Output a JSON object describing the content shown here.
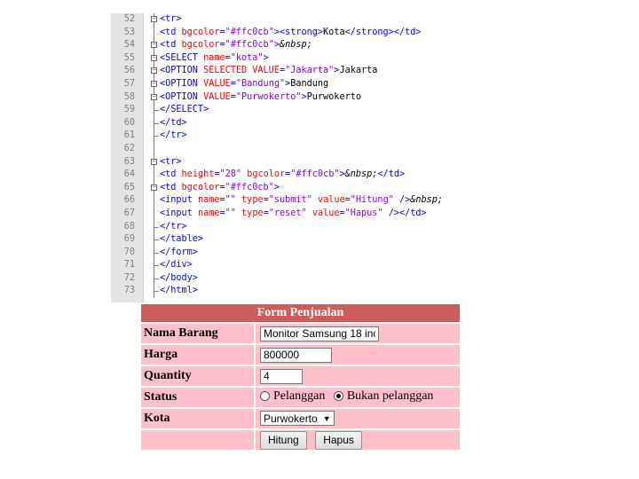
{
  "editor": {
    "lines": [
      {
        "num": "52",
        "fold": "minus",
        "tokens": [
          [
            "tag",
            "<tr>"
          ]
        ]
      },
      {
        "num": "53",
        "fold": "bar",
        "tokens": [
          [
            "tag",
            "<td "
          ],
          [
            "attr",
            "bgcolor"
          ],
          [
            "tag",
            "="
          ],
          [
            "val",
            "\"#ffc0cb\""
          ],
          [
            "tag",
            ">"
          ],
          [
            "tag",
            "<strong>"
          ],
          [
            "plain",
            "Kota"
          ],
          [
            "tag",
            "</strong>"
          ],
          [
            "tag",
            "</td>"
          ]
        ]
      },
      {
        "num": "54",
        "fold": "minus",
        "tokens": [
          [
            "tag",
            "<td "
          ],
          [
            "attr",
            "bgcolor"
          ],
          [
            "tag",
            "="
          ],
          [
            "val",
            "\"#ffc0cb\""
          ],
          [
            "tag",
            ">"
          ],
          [
            "ent",
            "&nbsp;"
          ]
        ]
      },
      {
        "num": "55",
        "fold": "minus",
        "tokens": [
          [
            "tag",
            "<SELECT "
          ],
          [
            "attr",
            "name"
          ],
          [
            "tag",
            "="
          ],
          [
            "val",
            "\"kota\""
          ],
          [
            "tag",
            ">"
          ]
        ]
      },
      {
        "num": "56",
        "fold": "minus",
        "tokens": [
          [
            "tag",
            "<OPTION "
          ],
          [
            "attr",
            "SELECTED VALUE"
          ],
          [
            "tag",
            "="
          ],
          [
            "val",
            "\"Jakarta\""
          ],
          [
            "tag",
            ">"
          ],
          [
            "plain",
            "Jakarta"
          ]
        ]
      },
      {
        "num": "57",
        "fold": "minus",
        "tokens": [
          [
            "tag",
            "<OPTION "
          ],
          [
            "attr",
            "VALUE"
          ],
          [
            "tag",
            "="
          ],
          [
            "val",
            "\"Bandung\""
          ],
          [
            "tag",
            ">"
          ],
          [
            "plain",
            "Bandung"
          ]
        ]
      },
      {
        "num": "58",
        "fold": "minus",
        "tokens": [
          [
            "tag",
            "<OPTION "
          ],
          [
            "attr",
            "VALUE"
          ],
          [
            "tag",
            "="
          ],
          [
            "val",
            "\"Purwokerto\""
          ],
          [
            "tag",
            ">"
          ],
          [
            "plain",
            "Purwokerto"
          ]
        ]
      },
      {
        "num": "59",
        "fold": "end",
        "tokens": [
          [
            "tag",
            "</SELECT>"
          ]
        ]
      },
      {
        "num": "60",
        "fold": "end",
        "tokens": [
          [
            "tag",
            "</td>"
          ]
        ]
      },
      {
        "num": "61",
        "fold": "end",
        "tokens": [
          [
            "tag",
            "</tr>"
          ]
        ]
      },
      {
        "num": "62",
        "fold": "bar",
        "tokens": []
      },
      {
        "num": "63",
        "fold": "minus",
        "tokens": [
          [
            "tag",
            "<tr>"
          ]
        ]
      },
      {
        "num": "64",
        "fold": "bar",
        "tokens": [
          [
            "tag",
            "<td "
          ],
          [
            "attr",
            "height"
          ],
          [
            "tag",
            "="
          ],
          [
            "val",
            "\"28\""
          ],
          [
            "tag",
            " "
          ],
          [
            "attr",
            "bgcolor"
          ],
          [
            "tag",
            "="
          ],
          [
            "val",
            "\"#ffc0cb\""
          ],
          [
            "tag",
            ">"
          ],
          [
            "ent",
            "&nbsp;"
          ],
          [
            "tag",
            "</td>"
          ]
        ]
      },
      {
        "num": "65",
        "fold": "minus",
        "tokens": [
          [
            "tag",
            "<td "
          ],
          [
            "attr",
            "bgcolor"
          ],
          [
            "tag",
            "="
          ],
          [
            "val",
            "\"#ffc0cb\""
          ],
          [
            "tag",
            ">"
          ]
        ]
      },
      {
        "num": "66",
        "fold": "bar",
        "tokens": [
          [
            "tag",
            "<input "
          ],
          [
            "attr",
            "name"
          ],
          [
            "tag",
            "="
          ],
          [
            "val",
            "\"\""
          ],
          [
            "tag",
            " "
          ],
          [
            "attr",
            "type"
          ],
          [
            "tag",
            "="
          ],
          [
            "val",
            "\"submit\""
          ],
          [
            "tag",
            " "
          ],
          [
            "attr",
            "value"
          ],
          [
            "tag",
            "="
          ],
          [
            "val",
            "\"Hitung\""
          ],
          [
            "tag",
            " />"
          ],
          [
            "ent",
            "&nbsp;"
          ]
        ]
      },
      {
        "num": "67",
        "fold": "bar",
        "tokens": [
          [
            "tag",
            "<input "
          ],
          [
            "attr",
            "name"
          ],
          [
            "tag",
            "="
          ],
          [
            "val",
            "\"\""
          ],
          [
            "tag",
            " "
          ],
          [
            "attr",
            "type"
          ],
          [
            "tag",
            "="
          ],
          [
            "val",
            "\"reset\""
          ],
          [
            "tag",
            " "
          ],
          [
            "attr",
            "value"
          ],
          [
            "tag",
            "="
          ],
          [
            "val",
            "\"Hapus\""
          ],
          [
            "tag",
            " />"
          ],
          [
            "tag",
            "</td>"
          ]
        ]
      },
      {
        "num": "68",
        "fold": "end",
        "tokens": [
          [
            "tag",
            "</tr>"
          ]
        ]
      },
      {
        "num": "69",
        "fold": "end",
        "tokens": [
          [
            "tag",
            "</table>"
          ]
        ]
      },
      {
        "num": "70",
        "fold": "end",
        "tokens": [
          [
            "tag",
            "</form>"
          ]
        ]
      },
      {
        "num": "71",
        "fold": "end",
        "tokens": [
          [
            "tag",
            "</div>"
          ]
        ]
      },
      {
        "num": "72",
        "fold": "end",
        "tokens": [
          [
            "tag",
            "</body>"
          ]
        ]
      },
      {
        "num": "73",
        "fold": "end",
        "tokens": [
          [
            "tag",
            "</html>"
          ]
        ]
      }
    ]
  },
  "form": {
    "title": "Form Penjualan",
    "rows": {
      "nama_barang": {
        "label": "Nama Barang",
        "value": "Monitor Samsung 18 inc"
      },
      "harga": {
        "label": "Harga",
        "value": "800000"
      },
      "quantity": {
        "label": "Quantity",
        "value": "4"
      },
      "status": {
        "label": "Status",
        "options": [
          "Pelanggan",
          "Bukan pelanggan"
        ],
        "selected": "Bukan pelanggan"
      },
      "kota": {
        "label": "Kota",
        "value": "Purwokerto"
      }
    },
    "buttons": {
      "hitung": "Hitung",
      "hapus": "Hapus"
    }
  },
  "colors": {
    "header_bg": "#cd5c5c",
    "cell_bg": "#ffc0cb",
    "tag": "#0000ff",
    "attr": "#ff0000",
    "value": "#8000ff"
  }
}
